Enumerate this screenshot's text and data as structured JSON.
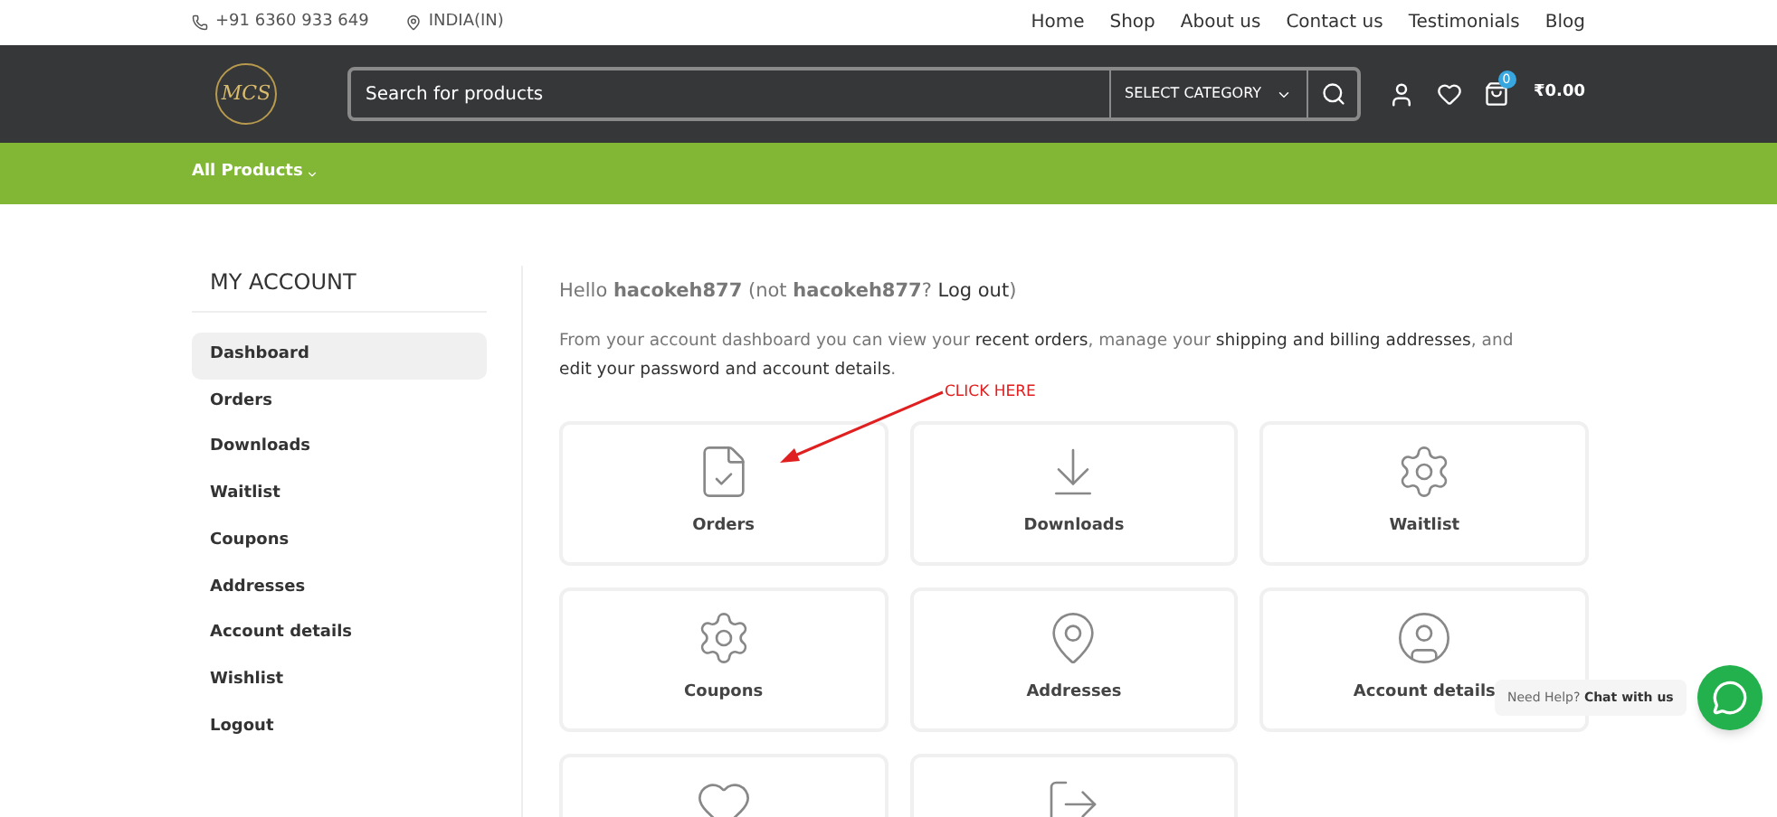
{
  "topbar": {
    "phone": "+91 6360 933 649",
    "location": "INDIA(IN)",
    "nav": [
      "Home",
      "Shop",
      "About us",
      "Contact us",
      "Testimonials",
      "Blog"
    ]
  },
  "header": {
    "logo": "MCS",
    "search": {
      "placeholder": "Search for products"
    },
    "category": "SELECT CATEGORY",
    "cart_count": "0",
    "cart_total": "₹0.00"
  },
  "menu_bar": {
    "label": "All Products"
  },
  "sidebar": {
    "title": "MY ACCOUNT",
    "items": [
      {
        "label": "Dashboard",
        "selected": true
      },
      {
        "label": "Orders",
        "selected": false
      },
      {
        "label": "Downloads",
        "selected": false
      },
      {
        "label": "Waitlist",
        "selected": false
      },
      {
        "label": "Coupons",
        "selected": false
      },
      {
        "label": "Addresses",
        "selected": false
      },
      {
        "label": "Account details",
        "selected": false
      },
      {
        "label": "Wishlist",
        "selected": false
      },
      {
        "label": "Logout",
        "selected": false
      }
    ]
  },
  "greeting": [
    {
      "text": "Hello **hacokeh877** (not **hacokeh877**? ",
      "link": false
    },
    {
      "text": "Log out",
      "link": true
    },
    {
      "text": ")",
      "link": false
    }
  ],
  "intro": [
    {
      "text": "From your account dashboard you can view your ",
      "link": false
    },
    {
      "text": "recent orders",
      "link": true
    },
    {
      "text": ", manage your ",
      "link": false
    },
    {
      "text": "shipping and billing addresses",
      "link": true
    },
    {
      "text": ", and ",
      "link": false
    },
    {
      "text": "edit your password and account details",
      "link": true
    },
    {
      "text": ".",
      "link": false
    }
  ],
  "annotation": {
    "text": "CLICK HERE"
  },
  "tiles": [
    {
      "kind": "orders",
      "label": "Orders"
    },
    {
      "kind": "downloads",
      "label": "Downloads"
    },
    {
      "kind": "waitlist",
      "label": "Waitlist"
    },
    {
      "kind": "coupons",
      "label": "Coupons"
    },
    {
      "kind": "addresses",
      "label": "Addresses"
    },
    {
      "kind": "account",
      "label": "Account details"
    },
    {
      "kind": "wishlist"
    },
    {
      "kind": "logout"
    }
  ],
  "chat": {
    "prefix": "Need Help?",
    "strong": "Chat with us"
  }
}
